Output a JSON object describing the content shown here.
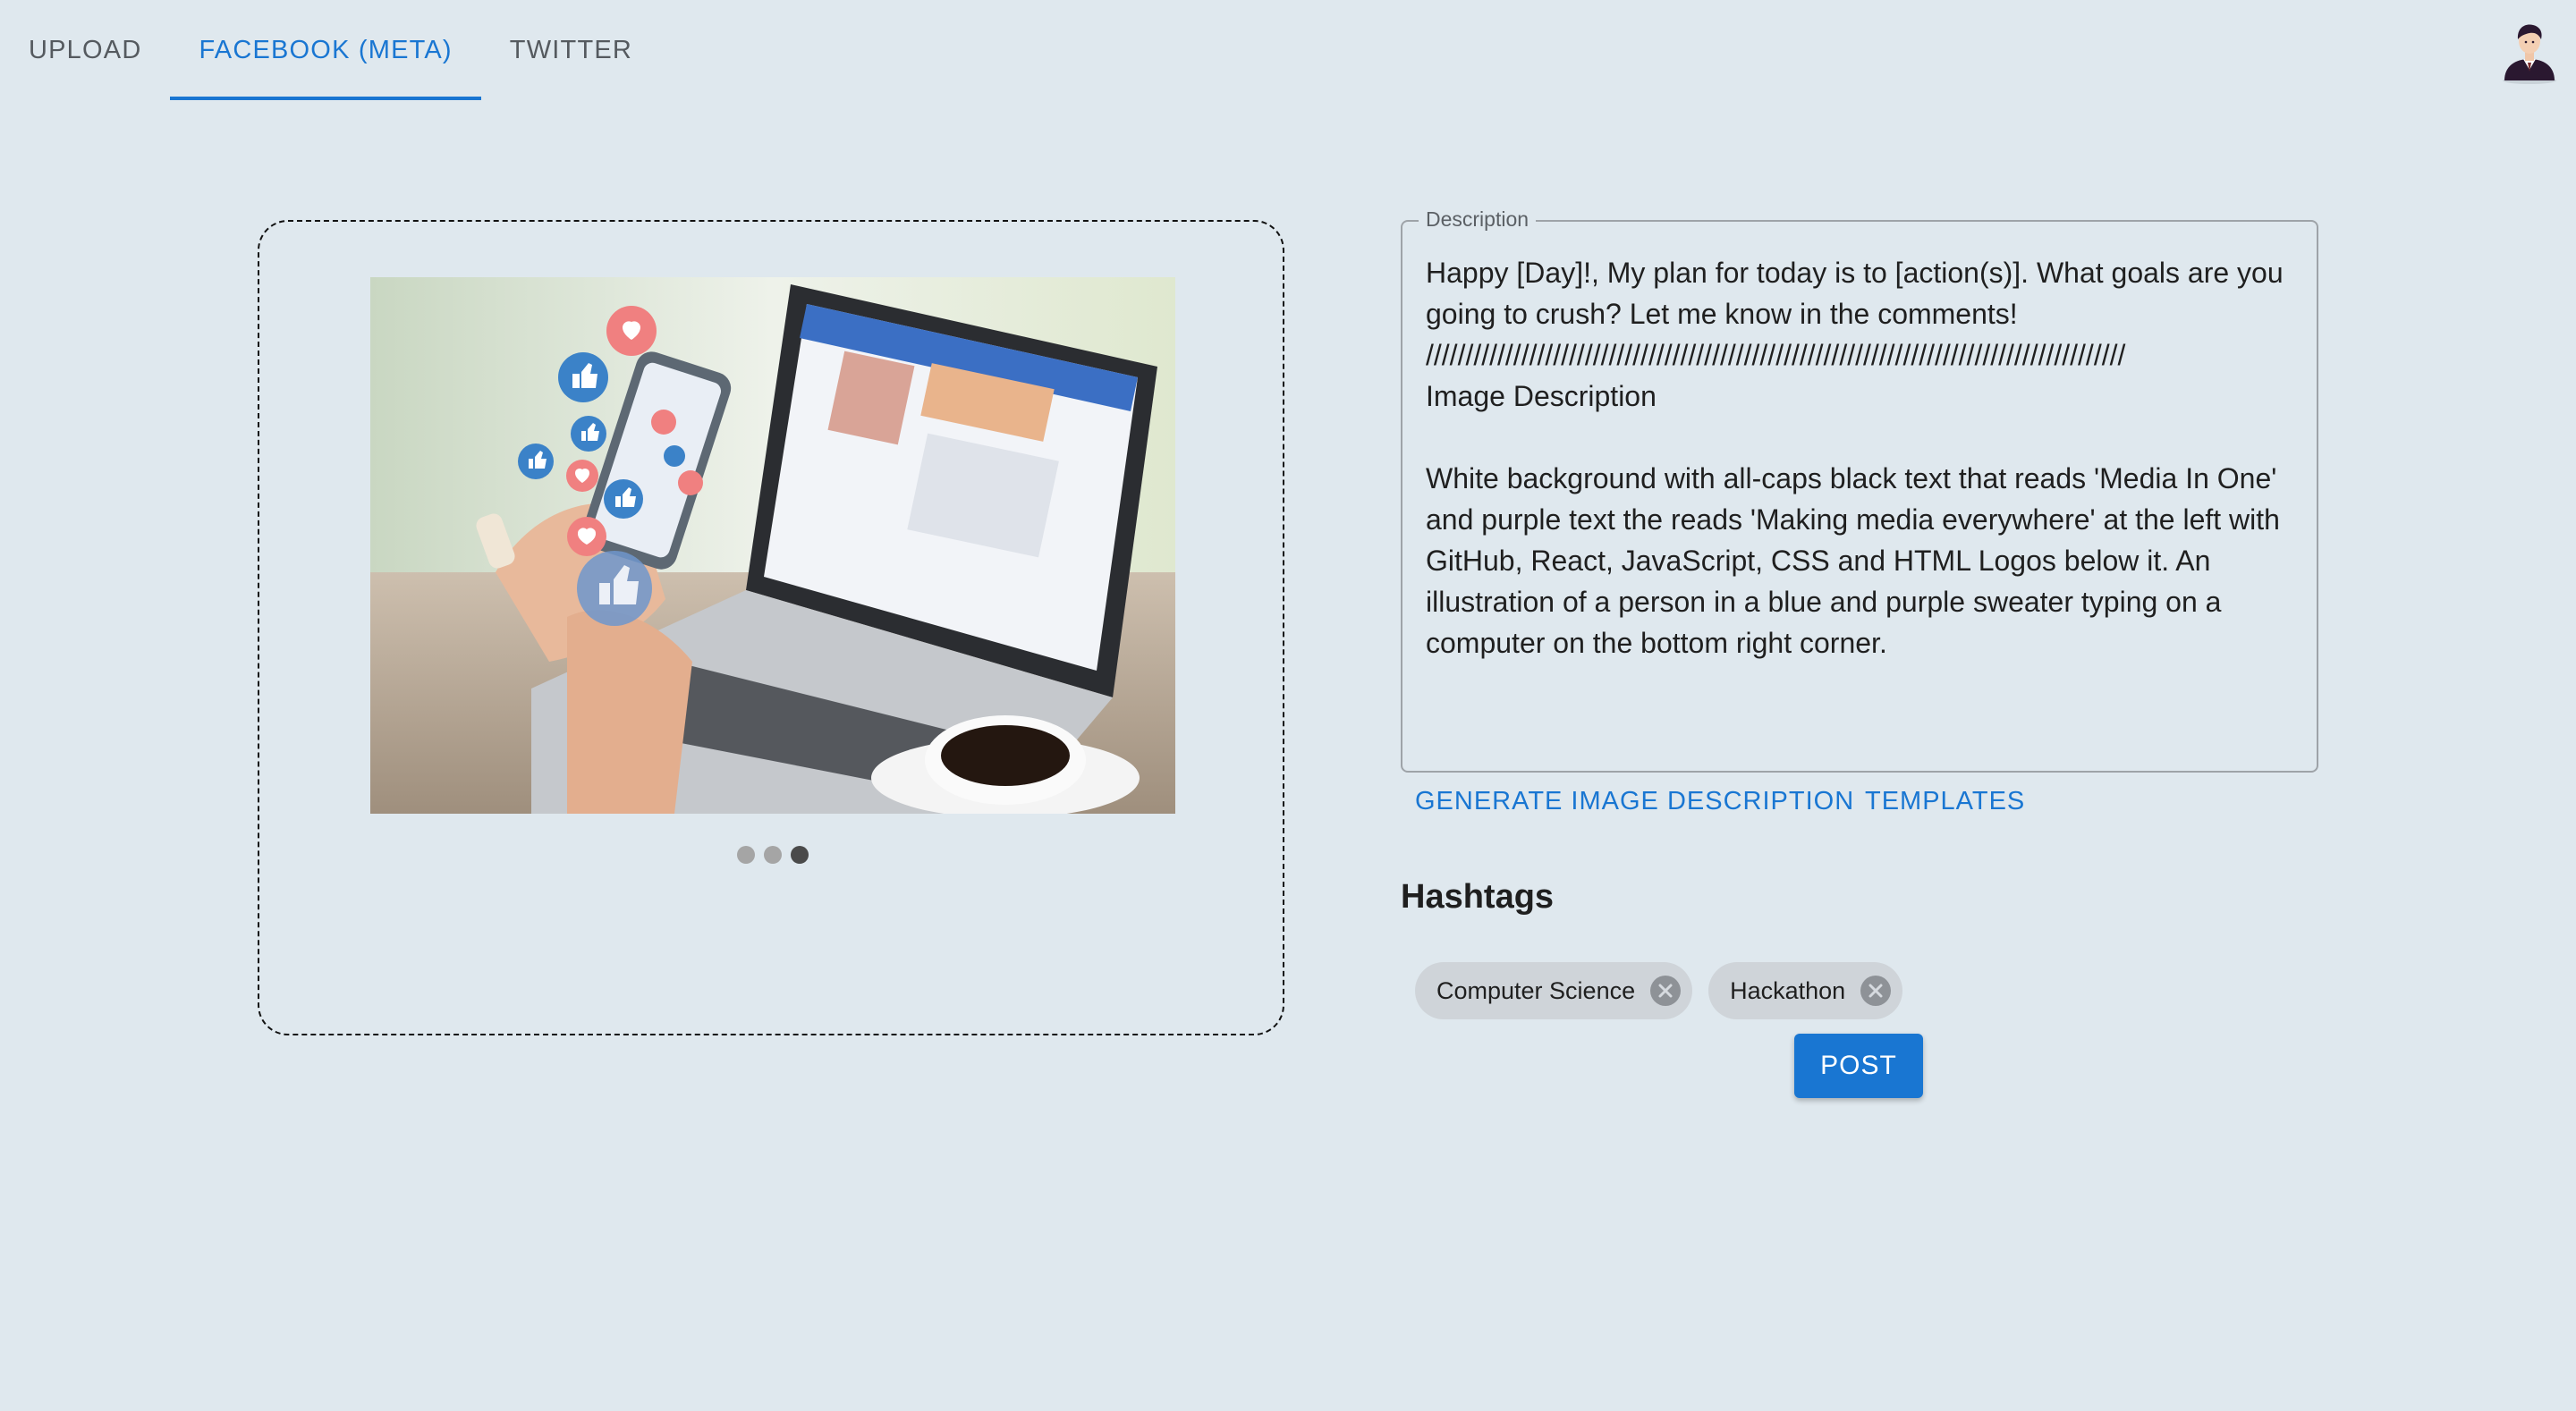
{
  "tabs": [
    {
      "label": "UPLOAD"
    },
    {
      "label": "FACEBOOK (META)"
    },
    {
      "label": "TWITTER"
    }
  ],
  "active_tab": "FACEBOOK (META)",
  "avatar": {
    "icon": "user-avatar-icon"
  },
  "carousel": {
    "image_icon": "social-media-photo",
    "slide_count": 3,
    "active_slide": 3
  },
  "description": {
    "label": "Description",
    "value": "Happy [Day]!, My plan for today is to [action(s)]. What goals are you going to crush? Let me know in the comments!\n////////////////////////////////////////////////////////////////////////////////////////\nImage Description\n\nWhite background with all-caps black text that reads 'Media In One' and purple text the reads 'Making media everywhere' at the left with GitHub, React, JavaScript, CSS and HTML Logos below it. An illustration of a person in a blue and purple sweater typing on a computer on the bottom right corner."
  },
  "actions": {
    "generate_label": "GENERATE IMAGE DESCRIPTION",
    "templates_label": "TEMPLATES"
  },
  "hashtags": {
    "title": "Hashtags",
    "chips": [
      {
        "label": "Computer Science"
      },
      {
        "label": "Hackathon"
      }
    ]
  },
  "post_button": {
    "label": "POST"
  },
  "colors": {
    "accent": "#1976d2",
    "background": "#dfe8ee",
    "chip": "#cfd4d9"
  }
}
